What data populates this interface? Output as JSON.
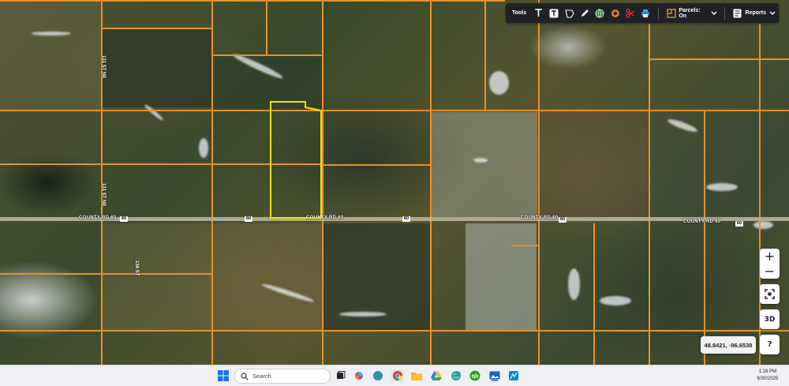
{
  "toolbar": {
    "tools_label": "Tools",
    "parcels_label": "Parcels: On",
    "reports_label": "Reports",
    "icons": [
      "text-icon",
      "text-box-icon",
      "polygon-icon",
      "pencil-icon",
      "globe-icon",
      "target-icon",
      "scissors-icon",
      "print-icon",
      "parcels-icon",
      "chevron-down-icon",
      "reports-icon",
      "chevron-down-icon"
    ]
  },
  "map": {
    "road_name": "COUNTY RD 60",
    "route_number": "60",
    "vertical_road_1": "131 ST NE",
    "vertical_road_2": "136 ST",
    "coordinates": "48.8421, -96.6538",
    "parcel_line_color": "#e8912a",
    "selected_parcel_color": "#e5e500"
  },
  "controls": {
    "zoom_in": "+",
    "zoom_out": "−",
    "three_d": "3D",
    "help": "?"
  },
  "taskbar": {
    "search_placeholder": "Search",
    "time": "1:16 PM",
    "date": "6/30/2025"
  }
}
